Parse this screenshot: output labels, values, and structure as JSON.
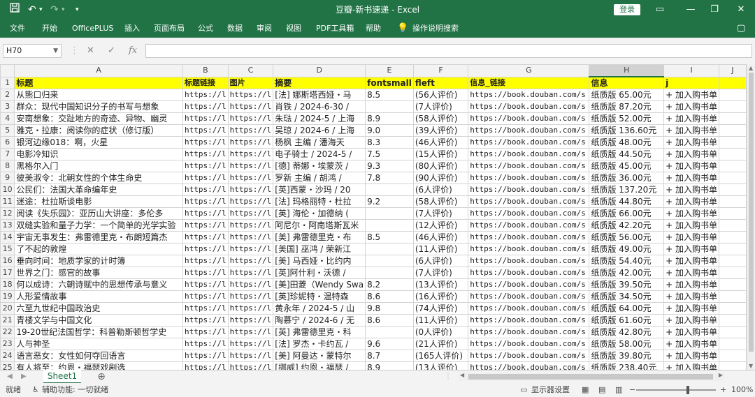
{
  "titlebar": {
    "title": "豆瓣-新书速递 - Excel",
    "login_label": "登录",
    "save_icon": "save-icon",
    "undo_icon": "undo-icon",
    "redo_icon": "redo-icon",
    "qa_more_icon": "chevron-down-icon"
  },
  "ribbon": {
    "tabs": [
      "文件",
      "开始",
      "OfficePLUS",
      "插入",
      "页面布局",
      "公式",
      "数据",
      "审阅",
      "视图",
      "PDF工具箱",
      "帮助"
    ],
    "tell_me": "操作说明搜索"
  },
  "formula_bar": {
    "name_box": "H70",
    "fx": "fx",
    "value": ""
  },
  "columns": [
    "A",
    "B",
    "C",
    "D",
    "E",
    "F",
    "G",
    "H",
    "I",
    "J"
  ],
  "selected_column": "H",
  "selected_row": "70",
  "header_row": [
    "标题",
    "标题链接",
    "图片",
    "摘要",
    "fontsmall",
    "fleft",
    "信息_链接",
    "信息",
    "j",
    ""
  ],
  "rows": [
    [
      "从熊口归来",
      "https://l",
      "https://l",
      "[法] 娜斯塔西娅・马",
      "8.5",
      "(56人评价)",
      "https://book.douban.com/s",
      "纸质版 65.00元",
      "+ 加入购书单",
      ""
    ],
    [
      "群众：现代中国知识分子的书写与想象",
      "https://l",
      "https://l",
      "肖铁 / 2024-6-30 /",
      "",
      "(7人评价)",
      "https://book.douban.com/s",
      "纸质版 87.20元",
      "+ 加入购书单",
      ""
    ],
    [
      "安南想象：交趾地方的奇迹、异物、幽灵",
      "https://l",
      "https://l",
      "朱琺 / 2024-5 / 上海",
      "8.9",
      "(58人评价)",
      "https://book.douban.com/s",
      "纸质版 52.00元",
      "+ 加入购书单",
      ""
    ],
    [
      "雅克・拉康：阅读你的症状（修订版）",
      "https://l",
      "https://l",
      "吴琼 / 2024-6 / 上海",
      "9.0",
      "(39人评价)",
      "https://book.douban.com/s",
      "纸质版 136.60元",
      "+ 加入购书单",
      ""
    ],
    [
      "银河边缘018：啊，火星",
      "https://l",
      "https://l",
      "杨枫 主编 / 潘海天",
      "8.3",
      "(46人评价)",
      "https://book.douban.com/s",
      "纸质版 48.00元",
      "+ 加入购书单",
      ""
    ],
    [
      "电影冷知识",
      "https://l",
      "https://l",
      "电子骑士 / 2024-5 /",
      "7.5",
      "(15人评价)",
      "https://book.douban.com/s",
      "纸质版 44.50元",
      "+ 加入购书单",
      ""
    ],
    [
      "黑格尔入门",
      "https://l",
      "https://l",
      "[德] 蒂娜・埃蒙茨 /",
      "9.3",
      "(80人评价)",
      "https://book.douban.com/s",
      "纸质版 45.00元",
      "+ 加入购书单",
      ""
    ],
    [
      "彼美淑令：北朝女性的个体生命史",
      "https://l",
      "https://l",
      "罗新 主编 / 胡鸿 /",
      "7.8",
      "(90人评价)",
      "https://book.douban.com/s",
      "纸质版 36.00元",
      "+ 加入购书单",
      ""
    ],
    [
      "公民们：法国大革命编年史",
      "https://l",
      "https://l",
      "[英]西蒙・沙玛 / 20",
      "",
      "(6人评价)",
      "https://book.douban.com/s",
      "纸质版 137.20元",
      "+ 加入购书单",
      ""
    ],
    [
      "迷途：杜拉斯谈电影",
      "https://l",
      "https://l",
      "[法] 玛格丽特・杜拉",
      "9.2",
      "(58人评价)",
      "https://book.douban.com/s",
      "纸质版 44.80元",
      "+ 加入购书单",
      ""
    ],
    [
      "阅读《失乐园》：亚历山大讲座：多伦多",
      "https://l",
      "https://l",
      "[英] 海伦・加德纳 (",
      "",
      "(7人评价)",
      "https://book.douban.com/s",
      "纸质版 66.00元",
      "+ 加入购书单",
      ""
    ],
    [
      "双缝实验和量子力学：一个简单的光学实验",
      "https://l",
      "https://l",
      "阿尼尔・阿南塔斯瓦米",
      "",
      "(12人评价)",
      "https://book.douban.com/s",
      "纸质版 42.20元",
      "+ 加入购书单",
      ""
    ],
    [
      "宇宙无事发生：弗雷德里克・布朗短篇杰",
      "https://l",
      "https://l",
      "[美] 弗雷德里克・布",
      "8.5",
      "(46人评价)",
      "https://book.douban.com/s",
      "纸质版 56.00元",
      "+ 加入购书单",
      ""
    ],
    [
      "了不起的敦煌",
      "https://l",
      "https://l",
      "[美国] 巫鸿 / 荣新江",
      "",
      "(11人评价)",
      "https://book.douban.com/s",
      "纸质版 49.00元",
      "+ 加入购书单",
      ""
    ],
    [
      "垂向时间：地质学家的计时簿",
      "https://l",
      "https://l",
      "[美] 马西娅・比约内",
      "",
      "(6人评价)",
      "https://book.douban.com/s",
      "纸质版 54.40元",
      "+ 加入购书单",
      ""
    ],
    [
      "世界之门：感官的故事",
      "https://l",
      "https://l",
      "[英]阿什利・沃德 /",
      "",
      "(7人评价)",
      "https://book.douban.com/s",
      "纸质版 42.00元",
      "+ 加入购书单",
      ""
    ],
    [
      "何以成诗：六朝诗赋中的思想传承与意义",
      "https://l",
      "https://l",
      "[美]田菱（Wendy Swa",
      "8.2",
      "(13人评价)",
      "https://book.douban.com/s",
      "纸质版 39.50元",
      "+ 加入购书单",
      ""
    ],
    [
      "人形爱情故事",
      "https://l",
      "https://l",
      "[英]珍妮特・温特森",
      "8.6",
      "(16人评价)",
      "https://book.douban.com/s",
      "纸质版 34.50元",
      "+ 加入购书单",
      ""
    ],
    [
      "六至九世纪中国政治史",
      "https://l",
      "https://l",
      "黄永年 / 2024-5 / 山",
      "9.8",
      "(74人评价)",
      "https://book.douban.com/s",
      "纸质版 64.00元",
      "+ 加入购书单",
      ""
    ],
    [
      "青楼文学与中国文化",
      "https://l",
      "https://l",
      "陶慕宁 / 2024-6 / 无",
      "8.6",
      "(11人评价)",
      "https://book.douban.com/s",
      "纸质版 61.60元",
      "+ 加入购书单",
      ""
    ],
    [
      "19-20世纪法国哲学：科普勒斯顿哲学史",
      "https://l",
      "https://l",
      "[英] 弗雷德里克・科",
      "",
      "(0人评价)",
      "https://book.douban.com/s",
      "纸质版 42.80元",
      "+ 加入购书单",
      ""
    ],
    [
      "人与神圣",
      "https://l",
      "https://l",
      "[法] 罗杰・卡约瓦 /",
      "9.6",
      "(21人评价)",
      "https://book.douban.com/s",
      "纸质版 58.00元",
      "+ 加入购书单",
      ""
    ],
    [
      "语言恶女：女性如何夺回语言",
      "https://l",
      "https://l",
      "[美] 阿曼达・蒙特尔",
      "8.7",
      "(165人评价)",
      "https://book.douban.com/s",
      "纸质版 39.80元",
      "+ 加入购书单",
      ""
    ],
    [
      "有人将至：约恩・福瑟戏剧选",
      "https://l",
      "https://l",
      "[挪威] 约恩・福瑟 /",
      "8.9",
      "(13人评价)",
      "https://book.douban.com/s",
      "纸质版 238.40元",
      "+ 加入购书单",
      ""
    ]
  ],
  "sheet_tabs": [
    "Sheet1"
  ],
  "statusbar": {
    "ready": "就绪",
    "accessibility": "辅助功能: 一切就绪",
    "display_settings": "显示器设置",
    "zoom_minus": "−",
    "zoom_plus": "+",
    "zoom": "100%"
  },
  "colors": {
    "excel_green": "#217346",
    "header_fill": "#ffff00"
  }
}
